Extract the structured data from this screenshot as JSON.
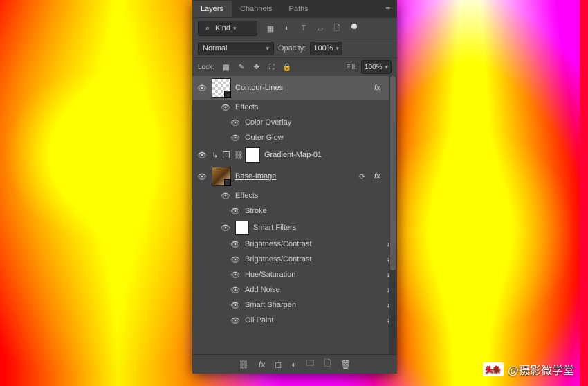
{
  "tabs": {
    "layers": "Layers",
    "channels": "Channels",
    "paths": "Paths"
  },
  "filter": {
    "search_icon": "⌕",
    "kind_label": "Kind"
  },
  "blend": {
    "mode": "Normal",
    "opacity_label": "Opacity:",
    "opacity_value": "100%"
  },
  "lock": {
    "label": "Lock:",
    "fill_label": "Fill:",
    "fill_value": "100%"
  },
  "layers_list": {
    "contour": {
      "name": "Contour-Lines",
      "fx": "fx"
    },
    "effects": "Effects",
    "color_overlay": "Color Overlay",
    "outer_glow": "Outer Glow",
    "gradient": "Gradient-Map-01",
    "base": {
      "name": "Base-Image ",
      "fx": "fx"
    },
    "stroke": "Stroke",
    "smart_filters": "Smart Filters",
    "bc1": "Brightness/Contrast",
    "bc2": "Brightness/Contrast",
    "hs": "Hue/Saturation",
    "noise": "Add Noise",
    "sharpen": "Smart Sharpen",
    "oil": "Oil Paint"
  },
  "watermark": {
    "badge": "头条",
    "text": "@摄影微学堂"
  }
}
